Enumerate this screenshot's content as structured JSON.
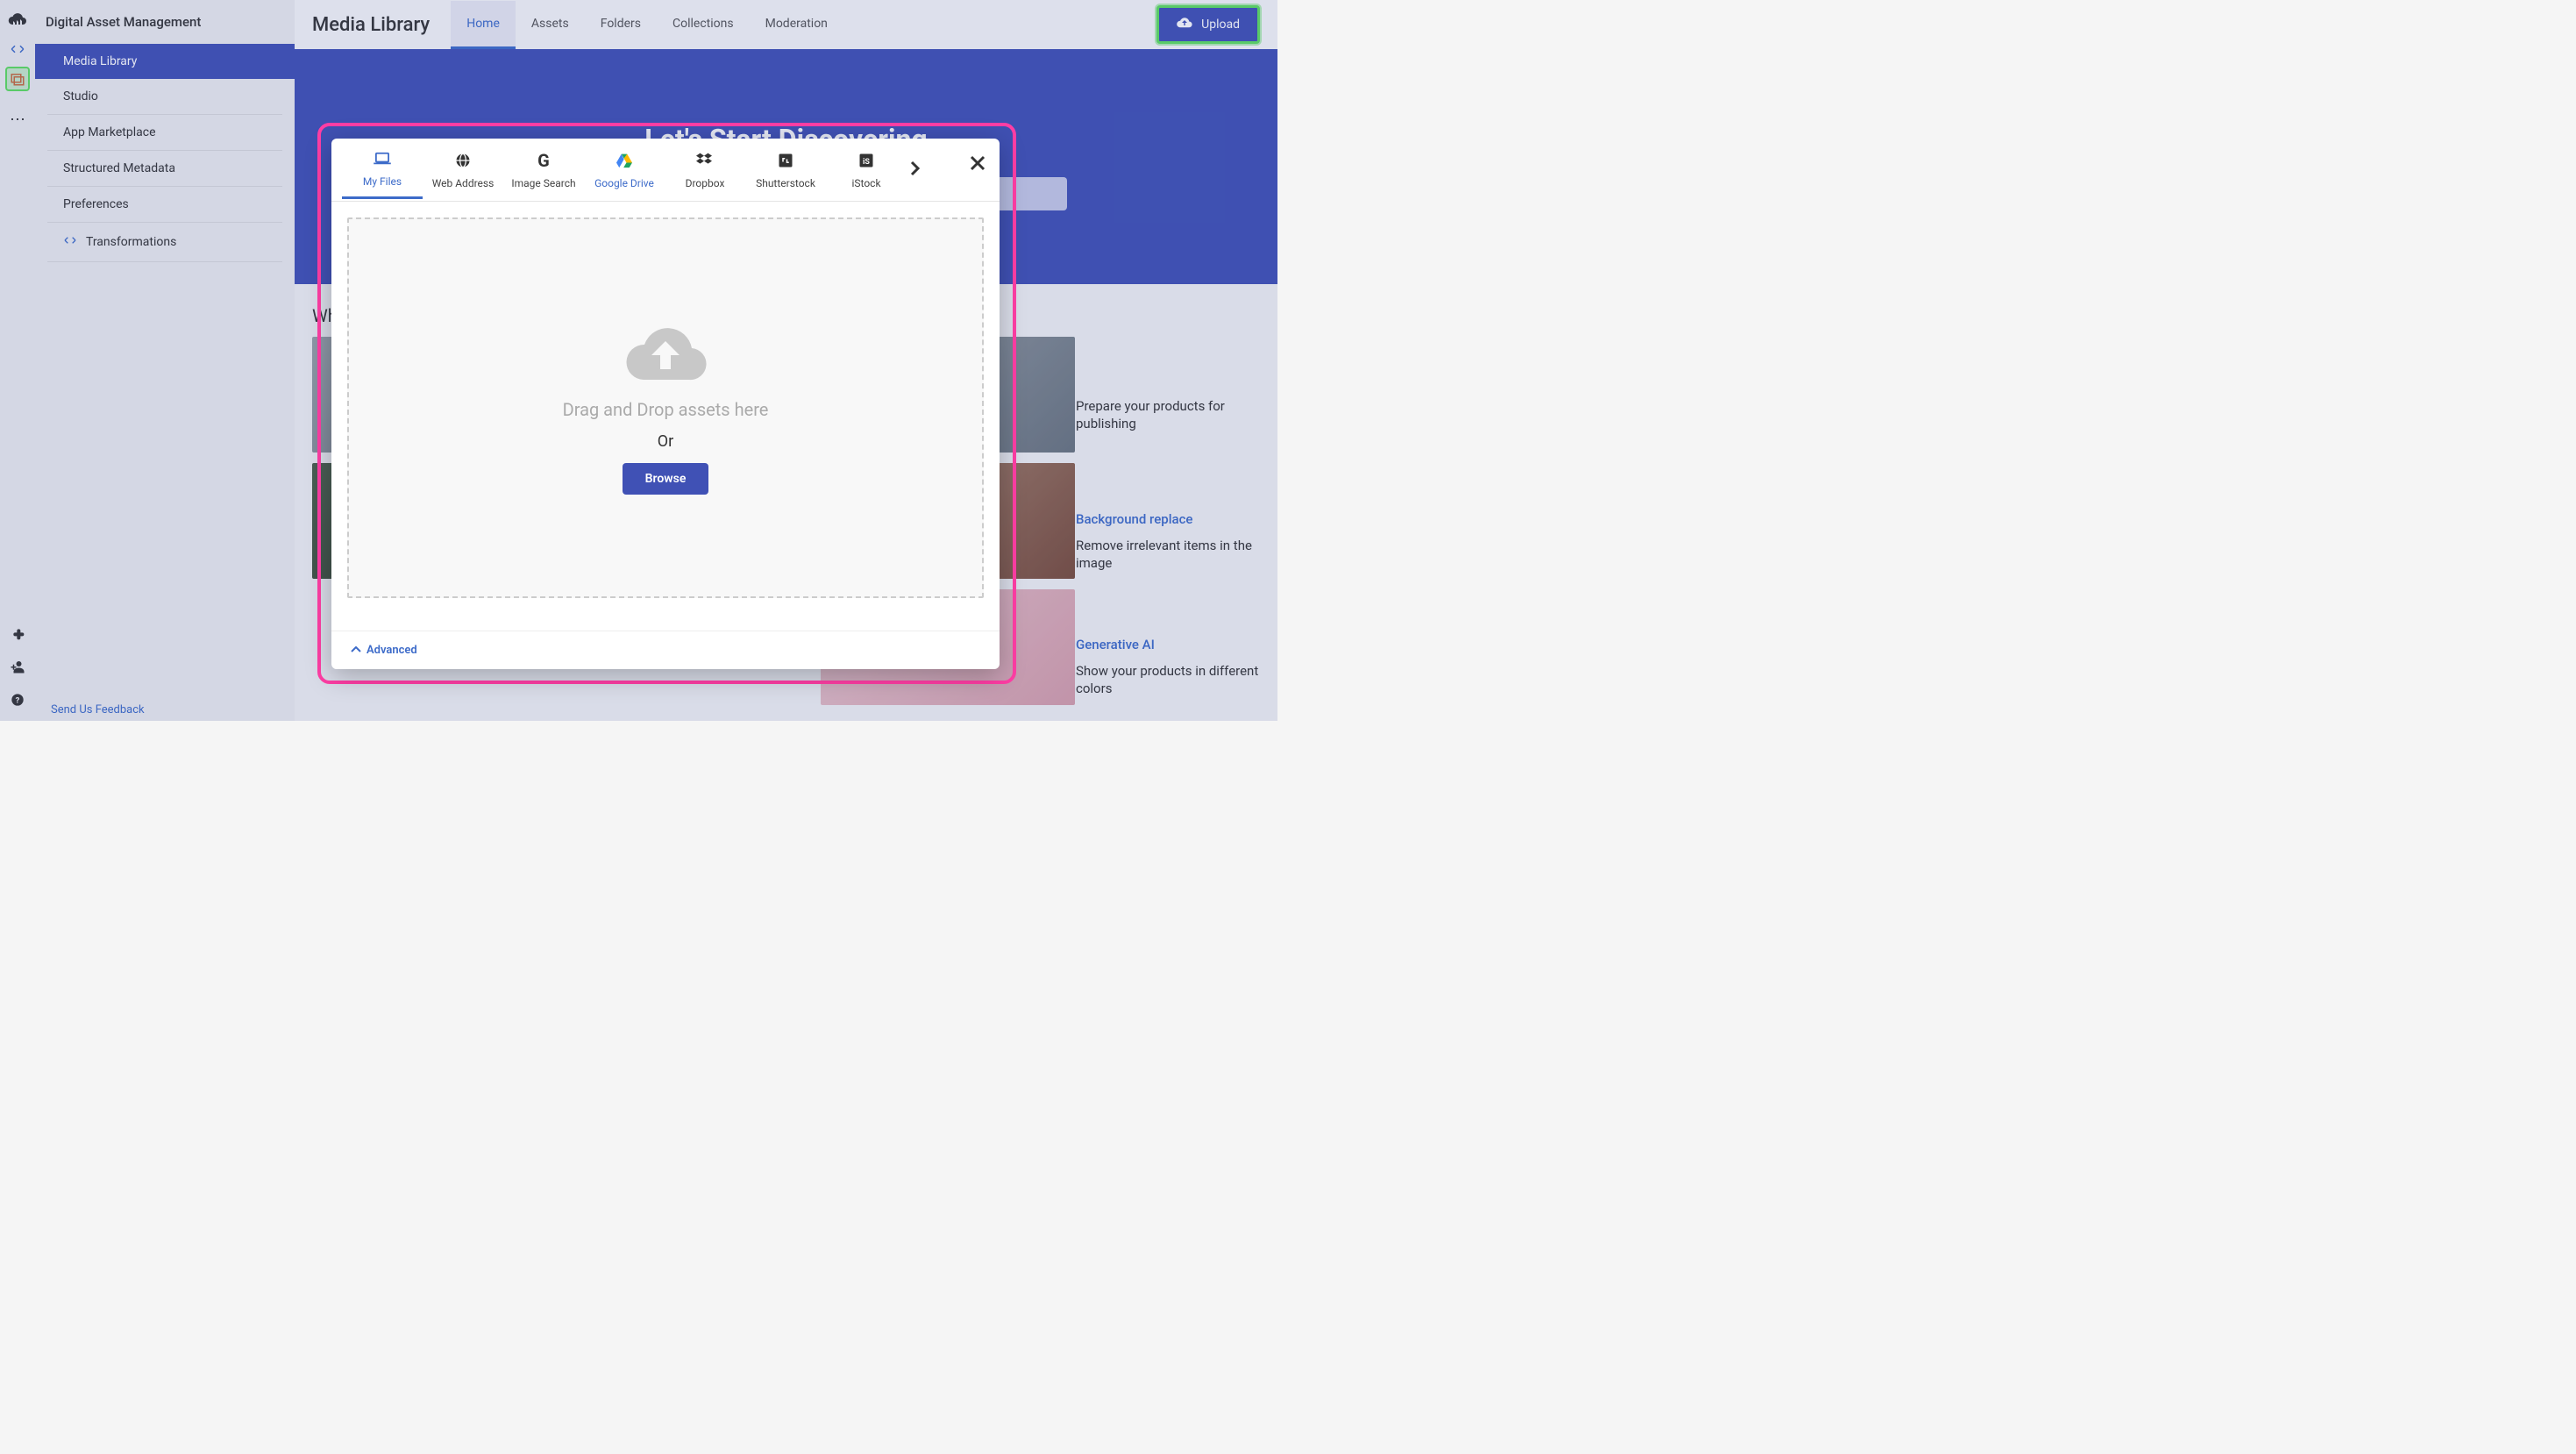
{
  "app": {
    "title": "Digital Asset Management"
  },
  "sidebar": {
    "items": [
      {
        "label": "Media Library"
      },
      {
        "label": "Studio"
      },
      {
        "label": "App Marketplace"
      },
      {
        "label": "Structured Metadata"
      },
      {
        "label": "Preferences"
      },
      {
        "label": "Transformations"
      }
    ],
    "feedback": "Send Us Feedback"
  },
  "topbar": {
    "title": "Media Library",
    "tabs": [
      {
        "label": "Home"
      },
      {
        "label": "Assets"
      },
      {
        "label": "Folders"
      },
      {
        "label": "Collections"
      },
      {
        "label": "Moderation"
      }
    ],
    "upload_label": "Upload"
  },
  "hero": {
    "title": "Let's Start Discovering"
  },
  "section": {
    "title": "What's new"
  },
  "right_list": {
    "r1_desc": "Prepare your products for publishing",
    "r2_hdr": "Background replace",
    "r2_desc": "Remove irrelevant items in the image",
    "r3_hdr": "Generative AI",
    "r3_desc": "Show your products in different colors"
  },
  "modal": {
    "tabs": [
      {
        "label": "My Files"
      },
      {
        "label": "Web Address"
      },
      {
        "label": "Image Search"
      },
      {
        "label": "Google Drive"
      },
      {
        "label": "Dropbox"
      },
      {
        "label": "Shutterstock"
      },
      {
        "label": "iStock"
      }
    ],
    "drop_text": "Drag and Drop assets here",
    "or_text": "Or",
    "browse_label": "Browse",
    "advanced_label": "Advanced"
  }
}
